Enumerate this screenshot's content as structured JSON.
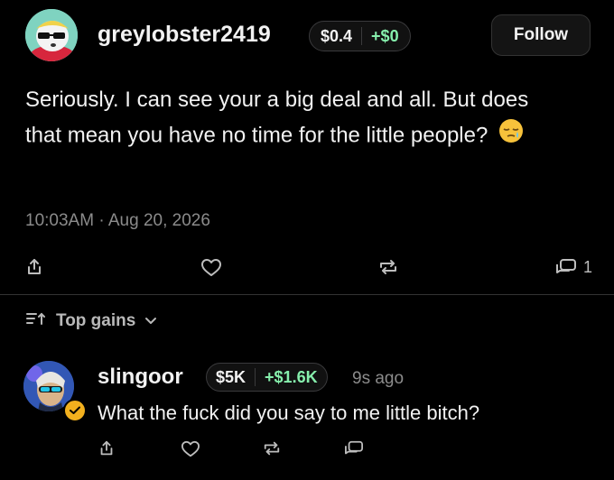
{
  "post": {
    "username": "greylobster2419",
    "price": "$0.4",
    "change": "+$0",
    "follow_label": "Follow",
    "text": "Seriously. I can see your a big deal and all. But does that mean you have no time for the little people?",
    "emoji": "sleepy-face-emoji",
    "timestamp": "10:03AM · Aug 20, 2026",
    "actions": {
      "share_icon": "share-icon",
      "like_icon": "heart-icon",
      "repost_icon": "repost-icon",
      "reply_icon": "reply-icon",
      "reply_count": "1"
    }
  },
  "sort": {
    "label": "Top gains",
    "icon": "sort-ascending-icon"
  },
  "reply": {
    "username": "slingoor",
    "price": "$5K",
    "change": "+$1.6K",
    "time_ago": "9s ago",
    "text": "What the fuck did you say to me little bitch?",
    "verified_icon": "verified-badge-icon"
  },
  "colors": {
    "background": "#000000",
    "gain_green": "#86efac",
    "muted": "#8b8b8b",
    "badge_gold": "#f2b01e"
  }
}
